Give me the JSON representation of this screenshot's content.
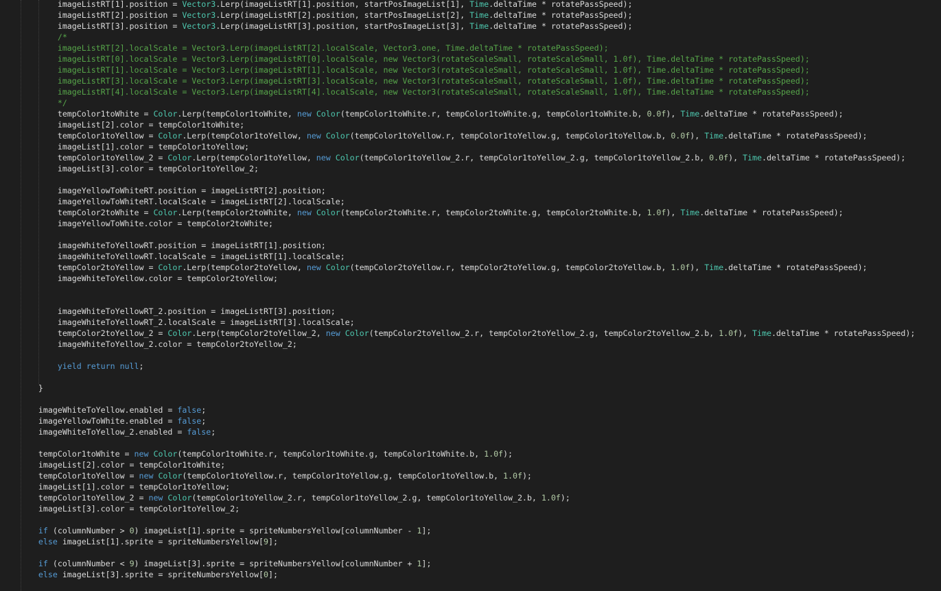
{
  "editor": {
    "theme": {
      "background": "#1e1e1e",
      "plain": "#dcdcdc",
      "keyword": "#569cd6",
      "type": "#4ec9b0",
      "comment": "#57a64a",
      "number": "#b5cea8"
    },
    "lines": [
      [
        [
          "pl",
          "        imageListRT[1].position = "
        ],
        [
          "ty",
          "Vector3"
        ],
        [
          "pl",
          ".Lerp(imageListRT[1].position, startPosImageList[1], "
        ],
        [
          "ty",
          "Time"
        ],
        [
          "pl",
          ".deltaTime * rotatePassSpeed);"
        ]
      ],
      [
        [
          "pl",
          "        imageListRT[2].position = "
        ],
        [
          "ty",
          "Vector3"
        ],
        [
          "pl",
          ".Lerp(imageListRT[2].position, startPosImageList[2], "
        ],
        [
          "ty",
          "Time"
        ],
        [
          "pl",
          ".deltaTime * rotatePassSpeed);"
        ]
      ],
      [
        [
          "pl",
          "        imageListRT[3].position = "
        ],
        [
          "ty",
          "Vector3"
        ],
        [
          "pl",
          ".Lerp(imageListRT[3].position, startPosImageList[3], "
        ],
        [
          "ty",
          "Time"
        ],
        [
          "pl",
          ".deltaTime * rotatePassSpeed);"
        ]
      ],
      [
        [
          "cm",
          "        /*"
        ]
      ],
      [
        [
          "cm",
          "        imageListRT[2].localScale = Vector3.Lerp(imageListRT[2].localScale, Vector3.one, Time.deltaTime * rotatePassSpeed);"
        ]
      ],
      [
        [
          "cm",
          "        imageListRT[0].localScale = Vector3.Lerp(imageListRT[0].localScale, new Vector3(rotateScaleSmall, rotateScaleSmall, 1.0f), Time.deltaTime * rotatePassSpeed);"
        ]
      ],
      [
        [
          "cm",
          "        imageListRT[1].localScale = Vector3.Lerp(imageListRT[1].localScale, new Vector3(rotateScaleSmall, rotateScaleSmall, 1.0f), Time.deltaTime * rotatePassSpeed);"
        ]
      ],
      [
        [
          "cm",
          "        imageListRT[3].localScale = Vector3.Lerp(imageListRT[3].localScale, new Vector3(rotateScaleSmall, rotateScaleSmall, 1.0f), Time.deltaTime * rotatePassSpeed);"
        ]
      ],
      [
        [
          "cm",
          "        imageListRT[4].localScale = Vector3.Lerp(imageListRT[4].localScale, new Vector3(rotateScaleSmall, rotateScaleSmall, 1.0f), Time.deltaTime * rotatePassSpeed);"
        ]
      ],
      [
        [
          "cm",
          "        */"
        ]
      ],
      [
        [
          "pl",
          "        tempColor1toWhite = "
        ],
        [
          "ty",
          "Color"
        ],
        [
          "pl",
          ".Lerp(tempColor1toWhite, "
        ],
        [
          "kw",
          "new"
        ],
        [
          "pl",
          " "
        ],
        [
          "ty",
          "Color"
        ],
        [
          "pl",
          "(tempColor1toWhite.r, tempColor1toWhite.g, tempColor1toWhite.b, "
        ],
        [
          "nu",
          "0.0f"
        ],
        [
          "pl",
          "), "
        ],
        [
          "ty",
          "Time"
        ],
        [
          "pl",
          ".deltaTime * rotatePassSpeed);"
        ]
      ],
      [
        [
          "pl",
          "        imageList[2].color = tempColor1toWhite;"
        ]
      ],
      [
        [
          "pl",
          "        tempColor1toYellow = "
        ],
        [
          "ty",
          "Color"
        ],
        [
          "pl",
          ".Lerp(tempColor1toYellow, "
        ],
        [
          "kw",
          "new"
        ],
        [
          "pl",
          " "
        ],
        [
          "ty",
          "Color"
        ],
        [
          "pl",
          "(tempColor1toYellow.r, tempColor1toYellow.g, tempColor1toYellow.b, "
        ],
        [
          "nu",
          "0.0f"
        ],
        [
          "pl",
          "), "
        ],
        [
          "ty",
          "Time"
        ],
        [
          "pl",
          ".deltaTime * rotatePassSpeed);"
        ]
      ],
      [
        [
          "pl",
          "        imageList[1].color = tempColor1toYellow;"
        ]
      ],
      [
        [
          "pl",
          "        tempColor1toYellow_2 = "
        ],
        [
          "ty",
          "Color"
        ],
        [
          "pl",
          ".Lerp(tempColor1toYellow, "
        ],
        [
          "kw",
          "new"
        ],
        [
          "pl",
          " "
        ],
        [
          "ty",
          "Color"
        ],
        [
          "pl",
          "(tempColor1toYellow_2.r, tempColor1toYellow_2.g, tempColor1toYellow_2.b, "
        ],
        [
          "nu",
          "0.0f"
        ],
        [
          "pl",
          "), "
        ],
        [
          "ty",
          "Time"
        ],
        [
          "pl",
          ".deltaTime * rotatePassSpeed);"
        ]
      ],
      [
        [
          "pl",
          "        imageList[3].color = tempColor1toYellow_2;"
        ]
      ],
      [],
      [
        [
          "pl",
          "        imageYellowToWhiteRT.position = imageListRT[2].position;"
        ]
      ],
      [
        [
          "pl",
          "        imageYellowToWhiteRT.localScale = imageListRT[2].localScale;"
        ]
      ],
      [
        [
          "pl",
          "        tempColor2toWhite = "
        ],
        [
          "ty",
          "Color"
        ],
        [
          "pl",
          ".Lerp(tempColor2toWhite, "
        ],
        [
          "kw",
          "new"
        ],
        [
          "pl",
          " "
        ],
        [
          "ty",
          "Color"
        ],
        [
          "pl",
          "(tempColor2toWhite.r, tempColor2toWhite.g, tempColor2toWhite.b, "
        ],
        [
          "nu",
          "1.0f"
        ],
        [
          "pl",
          "), "
        ],
        [
          "ty",
          "Time"
        ],
        [
          "pl",
          ".deltaTime * rotatePassSpeed);"
        ]
      ],
      [
        [
          "pl",
          "        imageYellowToWhite.color = tempColor2toWhite;"
        ]
      ],
      [],
      [
        [
          "pl",
          "        imageWhiteToYellowRT.position = imageListRT[1].position;"
        ]
      ],
      [
        [
          "pl",
          "        imageWhiteToYellowRT.localScale = imageListRT[1].localScale;"
        ]
      ],
      [
        [
          "pl",
          "        tempColor2toYellow = "
        ],
        [
          "ty",
          "Color"
        ],
        [
          "pl",
          ".Lerp(tempColor2toYellow, "
        ],
        [
          "kw",
          "new"
        ],
        [
          "pl",
          " "
        ],
        [
          "ty",
          "Color"
        ],
        [
          "pl",
          "(tempColor2toYellow.r, tempColor2toYellow.g, tempColor2toYellow.b, "
        ],
        [
          "nu",
          "1.0f"
        ],
        [
          "pl",
          "), "
        ],
        [
          "ty",
          "Time"
        ],
        [
          "pl",
          ".deltaTime * rotatePassSpeed);"
        ]
      ],
      [
        [
          "pl",
          "        imageWhiteToYellow.color = tempColor2toYellow;"
        ]
      ],
      [],
      [],
      [
        [
          "pl",
          "        imageWhiteToYellowRT_2.position = imageListRT[3].position;"
        ]
      ],
      [
        [
          "pl",
          "        imageWhiteToYellowRT_2.localScale = imageListRT[3].localScale;"
        ]
      ],
      [
        [
          "pl",
          "        tempColor2toYellow_2 = "
        ],
        [
          "ty",
          "Color"
        ],
        [
          "pl",
          ".Lerp(tempColor2toYellow_2, "
        ],
        [
          "kw",
          "new"
        ],
        [
          "pl",
          " "
        ],
        [
          "ty",
          "Color"
        ],
        [
          "pl",
          "(tempColor2toYellow_2.r, tempColor2toYellow_2.g, tempColor2toYellow_2.b, "
        ],
        [
          "nu",
          "1.0f"
        ],
        [
          "pl",
          "), "
        ],
        [
          "ty",
          "Time"
        ],
        [
          "pl",
          ".deltaTime * rotatePassSpeed);"
        ]
      ],
      [
        [
          "pl",
          "        imageWhiteToYellow_2.color = tempColor2toYellow_2;"
        ]
      ],
      [],
      [
        [
          "kw",
          "        yield return null"
        ],
        [
          "pl",
          ";"
        ]
      ],
      [],
      [
        [
          "pl",
          "    }"
        ]
      ],
      [],
      [
        [
          "pl",
          "    imageWhiteToYellow.enabled = "
        ],
        [
          "kw",
          "false"
        ],
        [
          "pl",
          ";"
        ]
      ],
      [
        [
          "pl",
          "    imageYellowToWhite.enabled = "
        ],
        [
          "kw",
          "false"
        ],
        [
          "pl",
          ";"
        ]
      ],
      [
        [
          "pl",
          "    imageWhiteToYellow_2.enabled = "
        ],
        [
          "kw",
          "false"
        ],
        [
          "pl",
          ";"
        ]
      ],
      [],
      [
        [
          "pl",
          "    tempColor1toWhite = "
        ],
        [
          "kw",
          "new"
        ],
        [
          "pl",
          " "
        ],
        [
          "ty",
          "Color"
        ],
        [
          "pl",
          "(tempColor1toWhite.r, tempColor1toWhite.g, tempColor1toWhite.b, "
        ],
        [
          "nu",
          "1.0f"
        ],
        [
          "pl",
          ");"
        ]
      ],
      [
        [
          "pl",
          "    imageList[2].color = tempColor1toWhite;"
        ]
      ],
      [
        [
          "pl",
          "    tempColor1toYellow = "
        ],
        [
          "kw",
          "new"
        ],
        [
          "pl",
          " "
        ],
        [
          "ty",
          "Color"
        ],
        [
          "pl",
          "(tempColor1toYellow.r, tempColor1toYellow.g, tempColor1toYellow.b, "
        ],
        [
          "nu",
          "1.0f"
        ],
        [
          "pl",
          ");"
        ]
      ],
      [
        [
          "pl",
          "    imageList[1].color = tempColor1toYellow;"
        ]
      ],
      [
        [
          "pl",
          "    tempColor1toYellow_2 = "
        ],
        [
          "kw",
          "new"
        ],
        [
          "pl",
          " "
        ],
        [
          "ty",
          "Color"
        ],
        [
          "pl",
          "(tempColor1toYellow_2.r, tempColor1toYellow_2.g, tempColor1toYellow_2.b, "
        ],
        [
          "nu",
          "1.0f"
        ],
        [
          "pl",
          ");"
        ]
      ],
      [
        [
          "pl",
          "    imageList[3].color = tempColor1toYellow_2;"
        ]
      ],
      [],
      [
        [
          "kw",
          "    if"
        ],
        [
          "pl",
          " (columnNumber > "
        ],
        [
          "nu",
          "0"
        ],
        [
          "pl",
          ") imageList[1].sprite = spriteNumbersYellow[columnNumber - "
        ],
        [
          "nu",
          "1"
        ],
        [
          "pl",
          "];"
        ]
      ],
      [
        [
          "kw",
          "    else"
        ],
        [
          "pl",
          " imageList[1].sprite = spriteNumbersYellow["
        ],
        [
          "nu",
          "9"
        ],
        [
          "pl",
          "];"
        ]
      ],
      [],
      [
        [
          "kw",
          "    if"
        ],
        [
          "pl",
          " (columnNumber < "
        ],
        [
          "nu",
          "9"
        ],
        [
          "pl",
          ") imageList[3].sprite = spriteNumbersYellow[columnNumber + "
        ],
        [
          "nu",
          "1"
        ],
        [
          "pl",
          "];"
        ]
      ],
      [
        [
          "kw",
          "    else"
        ],
        [
          "pl",
          " imageList[3].sprite = spriteNumbersYellow["
        ],
        [
          "nu",
          "0"
        ],
        [
          "pl",
          "];"
        ]
      ]
    ]
  }
}
